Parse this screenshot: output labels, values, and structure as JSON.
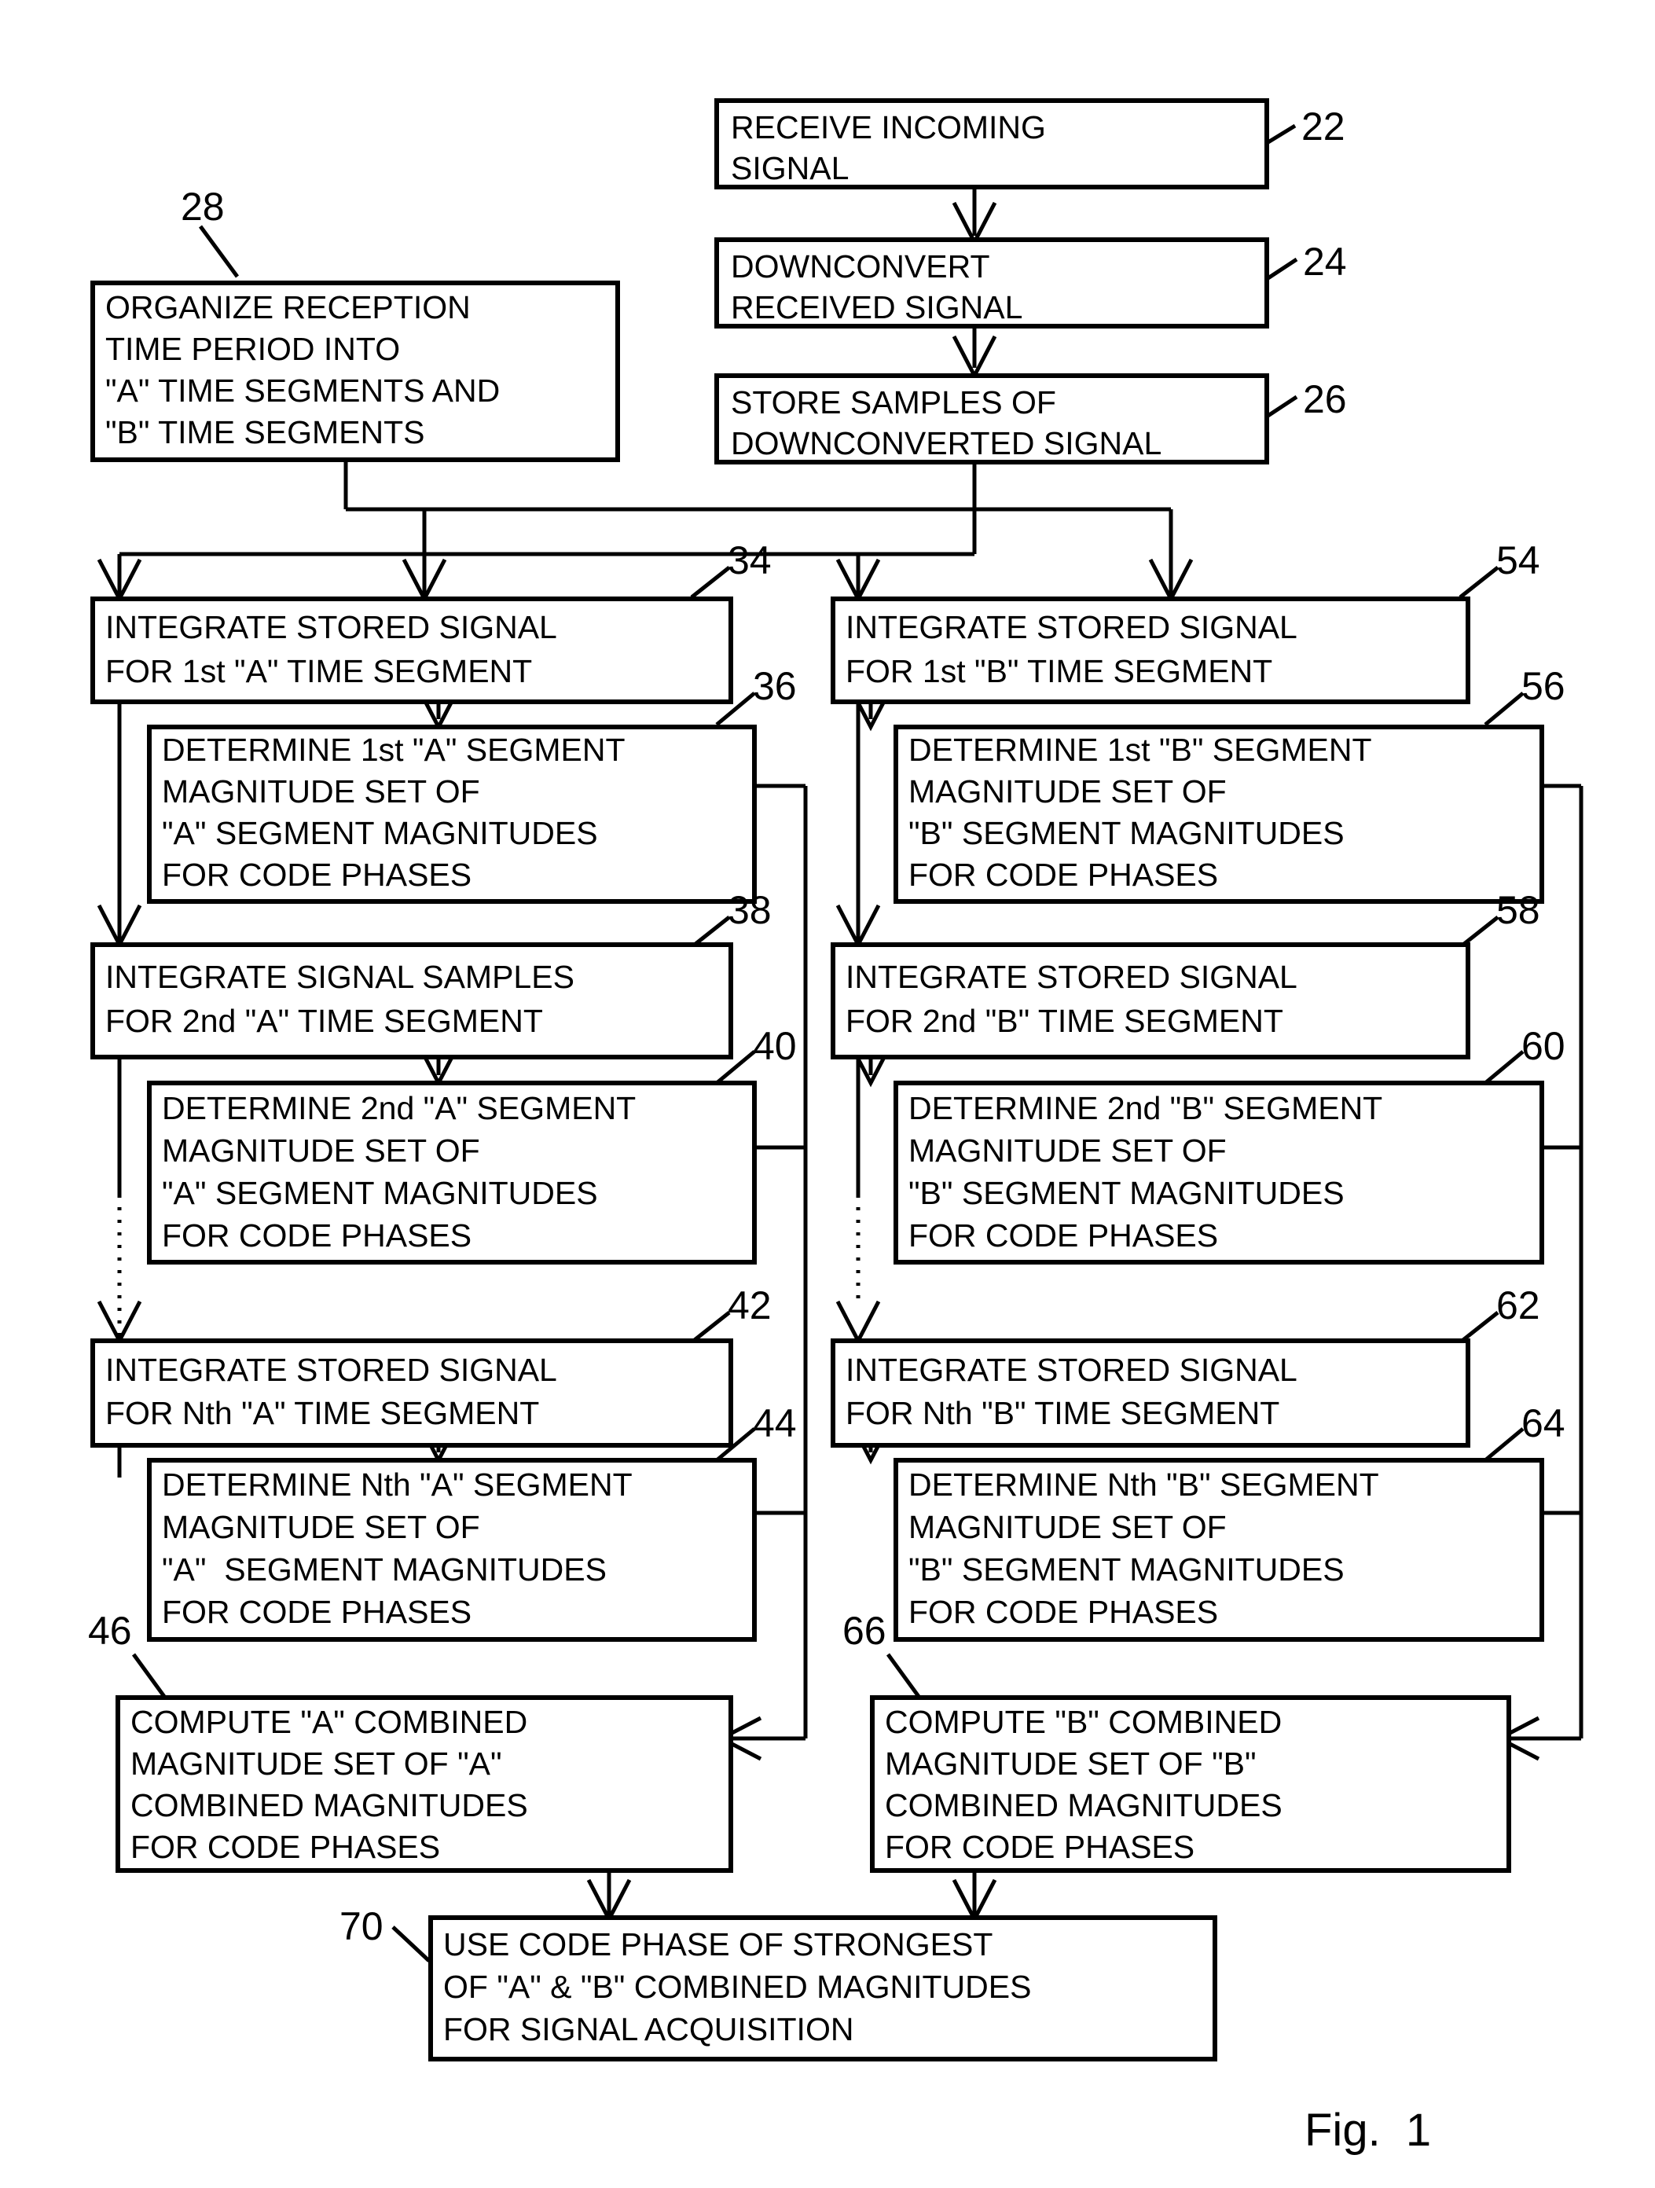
{
  "figure": {
    "caption": "Fig.  1",
    "title": "Signal acquisition flowchart"
  },
  "boxes": {
    "b22": {
      "ref": "22",
      "lines": [
        "RECEIVE INCOMING",
        "SIGNAL"
      ]
    },
    "b24": {
      "ref": "24",
      "lines": [
        "DOWNCONVERT",
        "RECEIVED SIGNAL"
      ]
    },
    "b26": {
      "ref": "26",
      "lines": [
        "STORE SAMPLES OF",
        "DOWNCONVERTED SIGNAL"
      ]
    },
    "b28": {
      "ref": "28",
      "lines": [
        "ORGANIZE RECEPTION",
        "TIME PERIOD INTO",
        "\"A\" TIME SEGMENTS AND",
        "\"B\" TIME SEGMENTS"
      ]
    },
    "b34": {
      "ref": "34",
      "lines": [
        "INTEGRATE STORED SIGNAL",
        "FOR 1st \"A\" TIME SEGMENT"
      ]
    },
    "b36": {
      "ref": "36",
      "lines": [
        "DETERMINE 1st \"A\" SEGMENT",
        "MAGNITUDE SET OF",
        "\"A\" SEGMENT MAGNITUDES",
        "FOR CODE PHASES"
      ]
    },
    "b38": {
      "ref": "38",
      "lines": [
        "INTEGRATE SIGNAL SAMPLES",
        "FOR 2nd \"A\" TIME SEGMENT"
      ]
    },
    "b40": {
      "ref": "40",
      "lines": [
        "DETERMINE 2nd \"A\" SEGMENT",
        "MAGNITUDE SET OF",
        "\"A\" SEGMENT MAGNITUDES",
        "FOR CODE PHASES"
      ]
    },
    "b42": {
      "ref": "42",
      "lines": [
        "INTEGRATE STORED SIGNAL",
        "FOR Nth \"A\" TIME SEGMENT"
      ]
    },
    "b44": {
      "ref": "44",
      "lines": [
        "DETERMINE Nth \"A\" SEGMENT",
        "MAGNITUDE SET OF",
        "\"A\"  SEGMENT MAGNITUDES",
        "FOR CODE PHASES"
      ]
    },
    "b46": {
      "ref": "46",
      "lines": [
        "COMPUTE \"A\" COMBINED",
        "MAGNITUDE SET OF \"A\"",
        "COMBINED MAGNITUDES",
        "FOR CODE PHASES"
      ]
    },
    "b54": {
      "ref": "54",
      "lines": [
        "INTEGRATE STORED SIGNAL",
        "FOR 1st \"B\" TIME SEGMENT"
      ]
    },
    "b56": {
      "ref": "56",
      "lines": [
        "DETERMINE 1st \"B\" SEGMENT",
        "MAGNITUDE SET OF",
        "\"B\" SEGMENT MAGNITUDES",
        "FOR CODE PHASES"
      ]
    },
    "b58": {
      "ref": "58",
      "lines": [
        "INTEGRATE STORED SIGNAL",
        "FOR 2nd \"B\" TIME SEGMENT"
      ]
    },
    "b60": {
      "ref": "60",
      "lines": [
        "DETERMINE 2nd \"B\" SEGMENT",
        "MAGNITUDE SET OF",
        "\"B\" SEGMENT MAGNITUDES",
        "FOR CODE PHASES"
      ]
    },
    "b62": {
      "ref": "62",
      "lines": [
        "INTEGRATE STORED SIGNAL",
        "FOR Nth \"B\" TIME SEGMENT"
      ]
    },
    "b64": {
      "ref": "64",
      "lines": [
        "DETERMINE Nth \"B\" SEGMENT",
        "MAGNITUDE SET OF",
        "\"B\" SEGMENT MAGNITUDES",
        "FOR CODE PHASES"
      ]
    },
    "b66": {
      "ref": "66",
      "lines": [
        "COMPUTE \"B\" COMBINED",
        "MAGNITUDE SET OF \"B\"",
        "COMBINED MAGNITUDES",
        "FOR CODE PHASES"
      ]
    },
    "b70": {
      "ref": "70",
      "lines": [
        "USE CODE PHASE OF STRONGEST",
        "OF \"A\" & \"B\" COMBINED MAGNITUDES",
        "FOR SIGNAL ACQUISITION"
      ]
    }
  },
  "colors": {
    "ink": "#000000",
    "paper": "#ffffff"
  }
}
